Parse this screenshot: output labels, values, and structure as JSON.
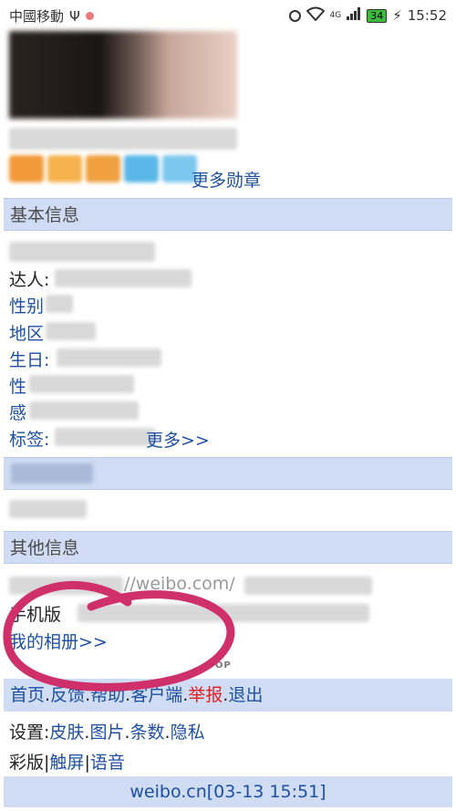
{
  "statusbar": {
    "carrier": "中國移動",
    "usb": "Ψ",
    "signal_label": "4G",
    "battery": "34",
    "time": "15:52"
  },
  "profile": {
    "more_medals": "更多勋章"
  },
  "basic_info": {
    "header": "基本信息",
    "daren": "达人:",
    "gender": "性别",
    "region": "地区",
    "birthday": "生日:",
    "orientation": "性",
    "relationship": "感",
    "tags": "标签:",
    "more": "更多>>"
  },
  "other_info": {
    "header": "其他信息",
    "url_prefix": "//weibo.com/",
    "mobile": "手机版",
    "album": "我的相册>>"
  },
  "top_mark": "TOP",
  "nav": {
    "home": "首页",
    "feedback": "反馈",
    "help": "帮助",
    "client": "客户端",
    "report": "举报",
    "logout": "退出"
  },
  "settings": {
    "label": "设置:",
    "skin": "皮肤",
    "pictures": "图片",
    "count": "条数",
    "privacy": "隐私"
  },
  "versions": {
    "color": "彩版",
    "touch": "触屏",
    "voice": "语音"
  },
  "footer": {
    "domain": "weibo.cn",
    "datetime": "[03-13 15:51]"
  },
  "colors": {
    "section_bg": "#cfdcf3",
    "link": "#1e50a2",
    "report_red": "#e02020",
    "scribble": "#d0306a"
  }
}
